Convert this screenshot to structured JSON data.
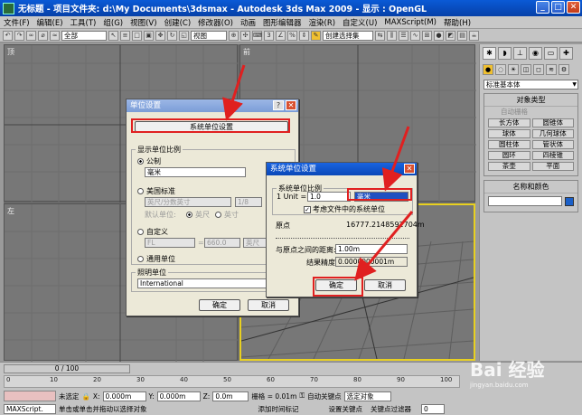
{
  "title": "无标题 - 项目文件夹: d:\\My Documents\\3dsmax - Autodesk 3ds Max 2009 - 显示 : OpenGL",
  "window_buttons": {
    "min": "_",
    "max": "□",
    "close": "✕"
  },
  "menu": [
    "文件(F)",
    "编辑(E)",
    "工具(T)",
    "组(G)",
    "视图(V)",
    "创建(C)",
    "修改器(O)",
    "动画",
    "图形编辑器",
    "渲染(R)",
    "自定义(U)",
    "MAXScript(M)",
    "帮助(H)"
  ],
  "toolbar": {
    "filter": "全部",
    "refcoord": "视图",
    "selset": "创建选择集"
  },
  "viewports": {
    "top_left": "顶",
    "top_right": "前",
    "bottom_left": "左",
    "bottom_right": "透视"
  },
  "cmdpanel": {
    "dropdown": "标准基本体",
    "rollout_object_type": "对象类型",
    "autogrid": "自动栅格",
    "objects": [
      "长方体",
      "圆锥体",
      "球体",
      "几何球体",
      "圆柱体",
      "管状体",
      "圆环",
      "四棱锥",
      "茶壶",
      "平面"
    ],
    "rollout_name_color": "名称和颜色",
    "swatch_color": "#1a5fc8"
  },
  "timeline": {
    "slider": "0 / 100",
    "ticks": [
      "0",
      "10",
      "20",
      "30",
      "40",
      "50",
      "60",
      "70",
      "80",
      "90",
      "100"
    ]
  },
  "status": {
    "none_selected": "未选定",
    "x_label": "X:",
    "x": "0.000m",
    "y_label": "Y:",
    "y": "0.000m",
    "z_label": "Z:",
    "z": "0.0m",
    "grid": "栅格 = 0.01m",
    "autokey": "自动关键点",
    "setkey": "设置关键点",
    "keyfilter": "关键点过滤器",
    "selected_obj": "选定对象",
    "maxscript": "MAXScript.",
    "prompt": "单击或单击并拖动以选择对象",
    "addtime": "添加时间标记",
    "frame": "0"
  },
  "dialog_units": {
    "title": "单位设置",
    "help_btn": "?",
    "close_btn": "✕",
    "system_units_button": "系统单位设置",
    "display_scale_group": "显示单位比例",
    "metric_label": "公制",
    "metric_value": "毫米",
    "us_label": "美国标准",
    "us_value": "英尺/分数英寸",
    "us_fraction": "1/8",
    "default_units_label": "默认单位:",
    "feet_label": "英尺",
    "inches_label": "英寸",
    "custom_label": "自定义",
    "custom_name": "FL",
    "custom_eq": "=",
    "custom_value": "660.0",
    "custom_unit": "英尺",
    "generic_label": "通用单位",
    "lighting_group": "照明单位",
    "lighting_value": "International",
    "ok": "确定",
    "cancel": "取消"
  },
  "dialog_system": {
    "title": "系统单位设置",
    "close_btn": "✕",
    "scale_group": "系统单位比例",
    "unit_label": "1 Unit =",
    "unit_value": "1.0",
    "unit_selected": "毫米",
    "consider_label": "考虑文件中的系统单位",
    "origin_label": "原点",
    "origin_value": "16777.2148592704m",
    "distance_label": "与原点之间的距离:",
    "distance_value": "1.00m",
    "accuracy_label": "结果精度:",
    "accuracy_value": "0.0000000001m",
    "ok": "确定",
    "cancel": "取消"
  },
  "watermark": {
    "text": "Bai 经验",
    "sub": "jingyan.baidu.com"
  }
}
